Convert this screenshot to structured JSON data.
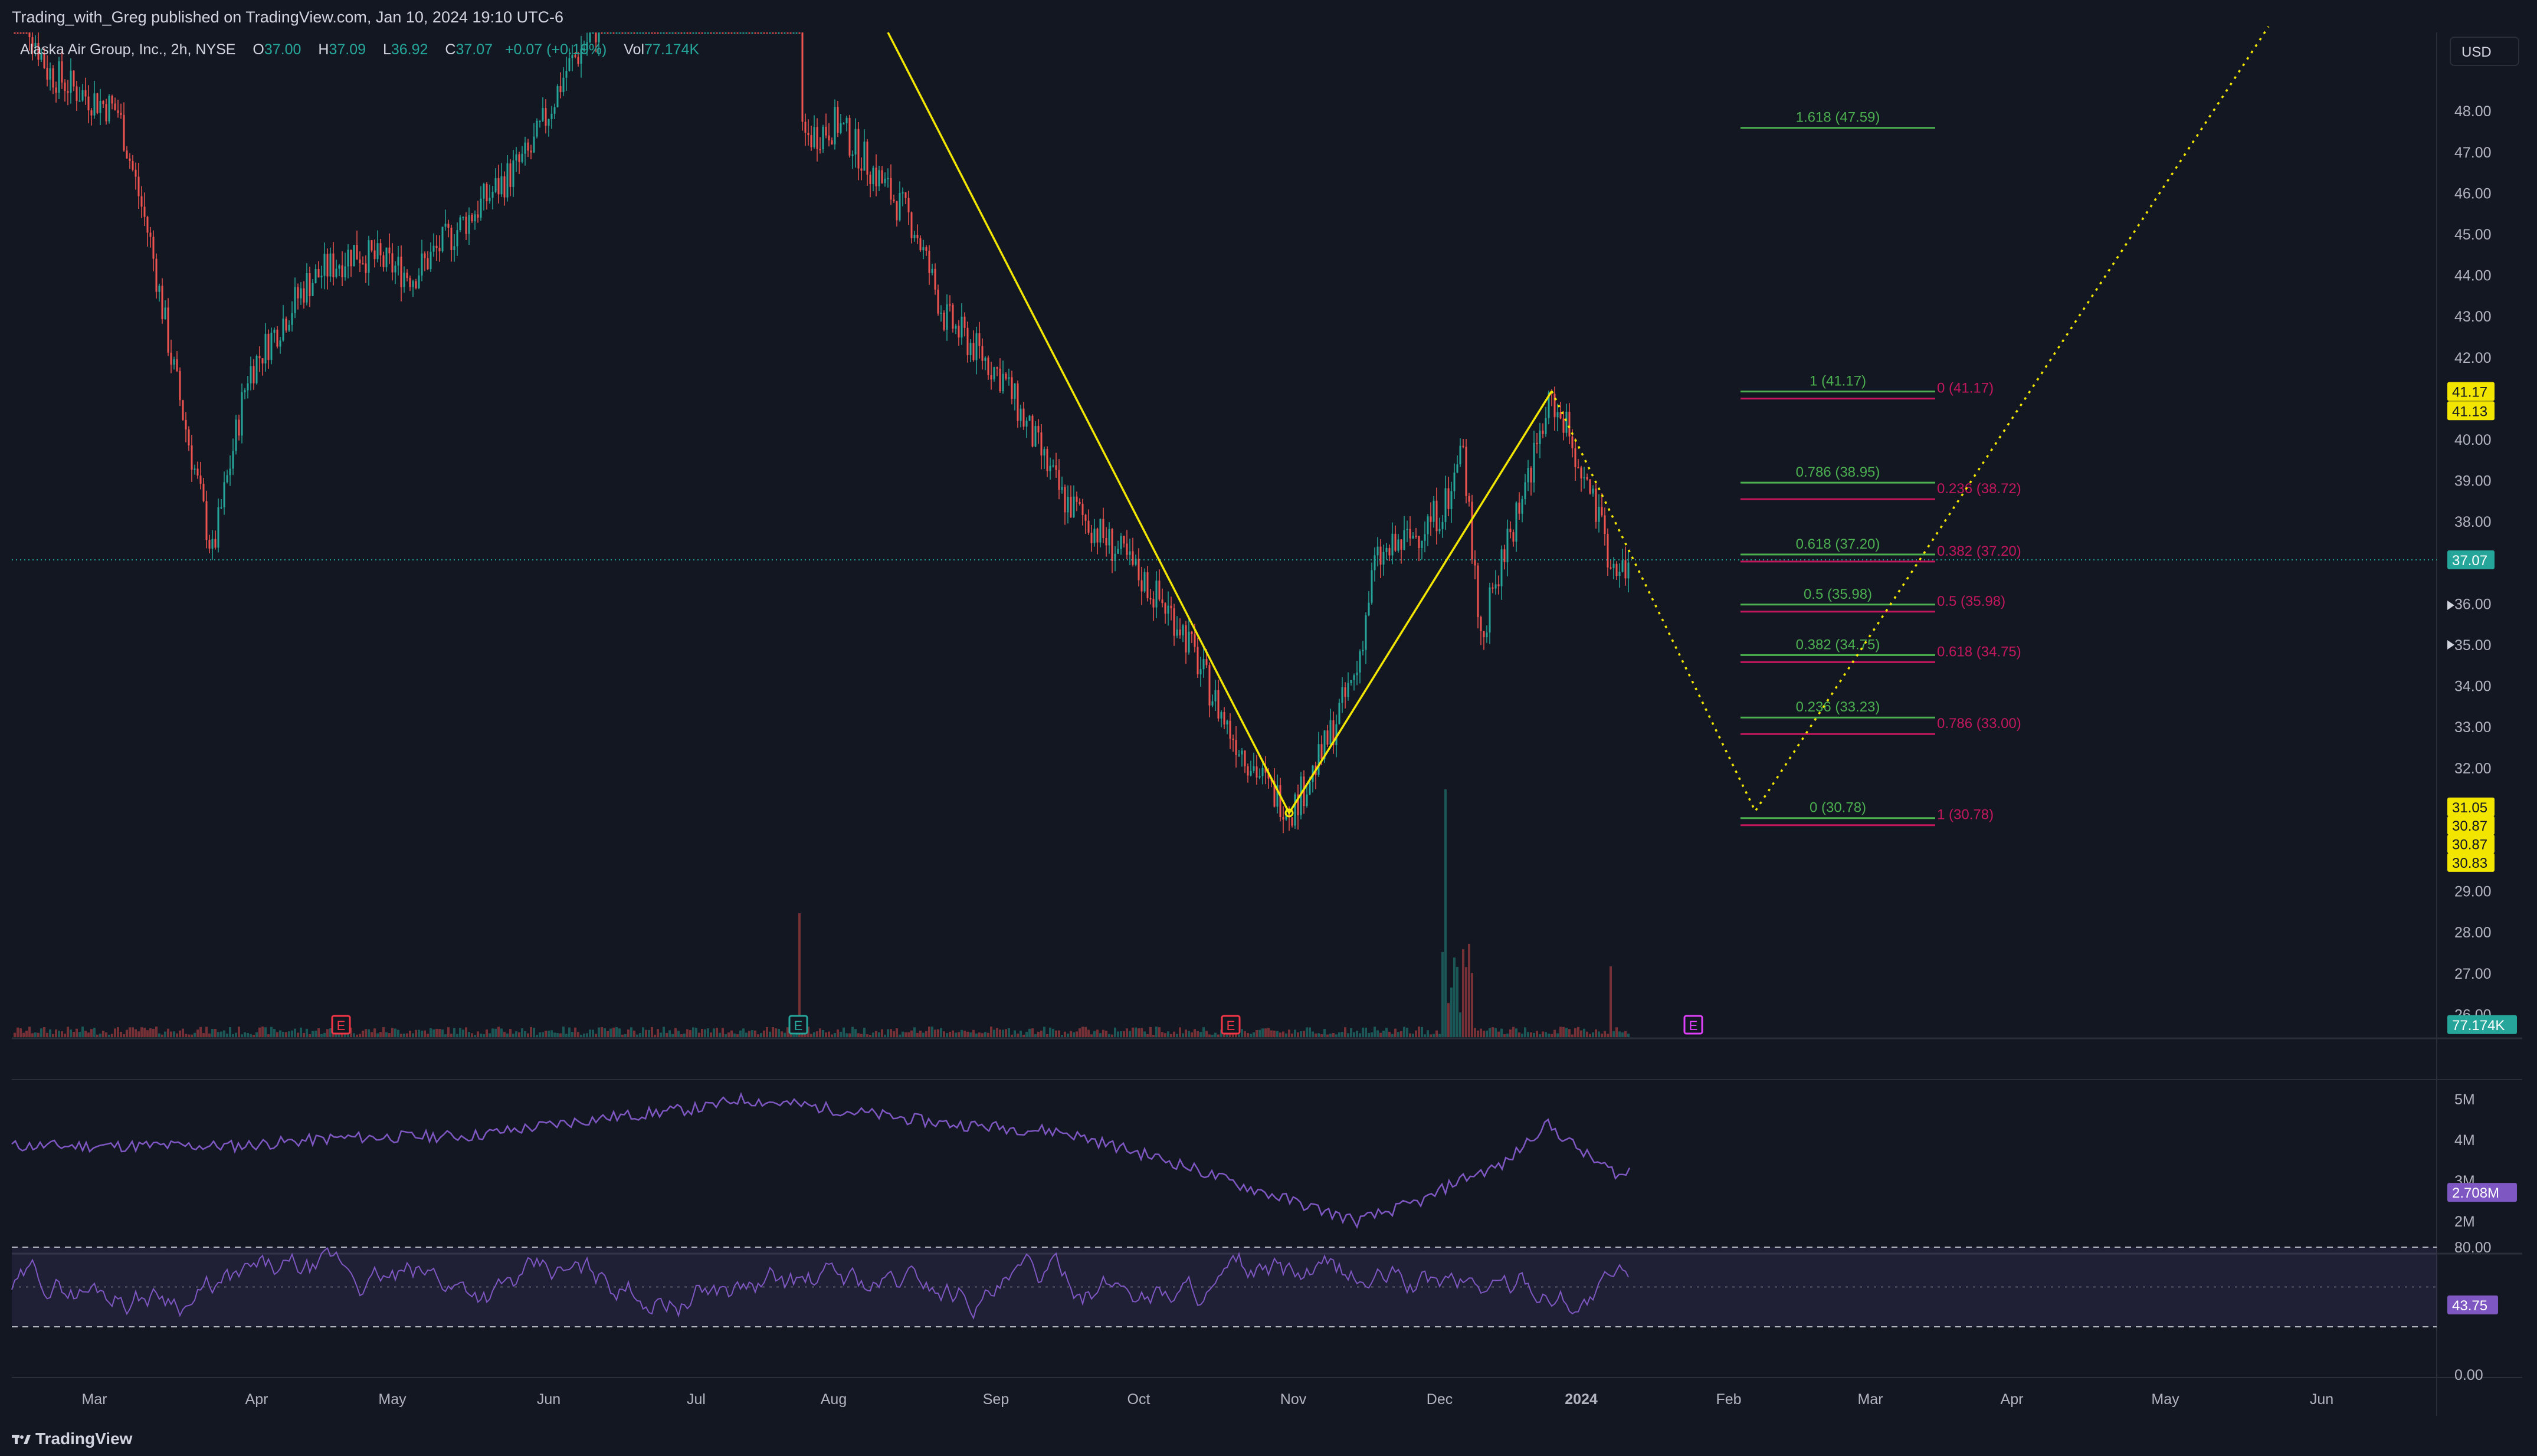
{
  "header": {
    "published_text": "Trading_with_Greg published on TradingView.com, Jan 10, 2024 19:10 UTC-6"
  },
  "legend": {
    "symbol": "Alaska Air Group, Inc., 2h, NYSE",
    "o_label": "O",
    "o_value": "37.00",
    "h_label": "H",
    "h_value": "37.09",
    "l_label": "L",
    "l_value": "36.92",
    "c_label": "C",
    "c_value": "37.07",
    "change": "+0.07 (+0.19%)",
    "vol_label": "Vol",
    "vol_value": "77.174K"
  },
  "currency_button": "USD",
  "price_scale": {
    "ticks": [
      "48.00",
      "47.00",
      "46.00",
      "45.00",
      "44.00",
      "43.00",
      "42.00",
      "40.00",
      "39.00",
      "38.00",
      "36.00",
      "35.00",
      "34.00",
      "33.00",
      "32.00",
      "29.00",
      "28.00",
      "27.00",
      "26.00"
    ],
    "tick_values": [
      48,
      47,
      46,
      45,
      44,
      43,
      42,
      40,
      39,
      38,
      36,
      35,
      34,
      33,
      32,
      29,
      28,
      27,
      26
    ],
    "badges": [
      {
        "text": "41.17",
        "color": "#f2e600",
        "text_color": "#131722",
        "value": 41.17
      },
      {
        "text": "41.13",
        "color": "#f2e600",
        "text_color": "#131722",
        "value": 40.7
      },
      {
        "text": "37.07",
        "color": "#26a69a",
        "text_color": "#ffffff",
        "value": 37.07
      },
      {
        "text": "31.05",
        "color": "#f2e600",
        "text_color": "#131722",
        "value": 31.05
      },
      {
        "text": "30.87",
        "color": "#f2e600",
        "text_color": "#131722",
        "value": 30.6
      },
      {
        "text": "30.87",
        "color": "#f2e600",
        "text_color": "#131722",
        "value": 30.15
      },
      {
        "text": "30.83",
        "color": "#f2e600",
        "text_color": "#131722",
        "value": 29.7
      },
      {
        "text": "77.174K",
        "color": "#26a69a",
        "text_color": "#ffffff",
        "value": 25.75
      }
    ]
  },
  "fib_retracement": {
    "color": "#4caf50",
    "levels": [
      {
        "label": "1.618 (47.59)",
        "price": 47.59
      },
      {
        "label": "1 (41.17)",
        "price": 41.17
      },
      {
        "label": "0.786 (38.95)",
        "price": 38.95
      },
      {
        "label": "0.618 (37.20)",
        "price": 37.2
      },
      {
        "label": "0.5 (35.98)",
        "price": 35.98
      },
      {
        "label": "0.382 (34.75)",
        "price": 34.75
      },
      {
        "label": "0.236 (33.23)",
        "price": 33.23
      },
      {
        "label": "0 (30.78)",
        "price": 30.78
      }
    ]
  },
  "fib_extension": {
    "color": "#c2185b",
    "levels": [
      {
        "label": "0 (41.17)",
        "price": 41.17
      },
      {
        "label": "0.236 (38.72)",
        "price": 38.72
      },
      {
        "label": "0.382 (37.20)",
        "price": 37.2
      },
      {
        "label": "0.5 (35.98)",
        "price": 35.98
      },
      {
        "label": "0.618 (34.75)",
        "price": 34.75
      },
      {
        "label": "0.786 (33.00)",
        "price": 33.0
      },
      {
        "label": "1 (30.78)",
        "price": 30.78
      }
    ]
  },
  "earnings_markers": [
    {
      "label": "E",
      "color": "#f23645"
    },
    {
      "label": "E",
      "color": "#26a69a"
    },
    {
      "label": "E",
      "color": "#f23645"
    },
    {
      "label": "E",
      "color": "#e040fb"
    }
  ],
  "indicator1": {
    "ticks": [
      "5M",
      "4M",
      "3M",
      "2M"
    ],
    "tick_values": [
      5,
      4,
      3,
      2
    ],
    "badge": "2.708M",
    "badge_value": 2.708,
    "color": "#7e57c2"
  },
  "indicator2": {
    "ticks": [
      "80.00",
      "0.00"
    ],
    "tick_values": [
      80,
      0
    ],
    "badge": "43.75",
    "badge_value": 43.75,
    "color": "#7e57c2",
    "upper_band": 70,
    "lower_band": 30
  },
  "time_axis": {
    "labels": [
      "Mar",
      "Apr",
      "May",
      "Jun",
      "Jul",
      "Aug",
      "Sep",
      "Oct",
      "Nov",
      "Dec",
      "2024",
      "Feb",
      "Mar",
      "Apr",
      "May",
      "Jun"
    ]
  },
  "footer": {
    "logo_text": "TradingView"
  },
  "colors": {
    "up": "#26a69a",
    "down": "#ef5350",
    "drawing": "#f2e600",
    "background": "#131722"
  }
}
